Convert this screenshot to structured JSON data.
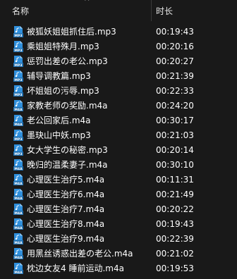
{
  "header": {
    "name_label": "名称",
    "duration_label": "时长",
    "sort_icon": "chevron-up-icon"
  },
  "files": [
    {
      "name": "被狐妖姐姐抓住后.mp3",
      "duration": "00:19:43",
      "type": "MP3"
    },
    {
      "name": "乘姐姐特殊月.mp3",
      "duration": "00:20:16",
      "type": "MP3"
    },
    {
      "name": "惩罚出差の老公.mp3",
      "duration": "00:20:27",
      "type": "MP3"
    },
    {
      "name": "辅导调教篇.mp3",
      "duration": "00:21:39",
      "type": "MP3"
    },
    {
      "name": "坏姐姐の污辱.mp3",
      "duration": "00:22:33",
      "type": "MP3"
    },
    {
      "name": "家教老师の奖励.m4a",
      "duration": "00:24:20",
      "type": "M4A"
    },
    {
      "name": "老公回家后.m4a",
      "duration": "00:30:17",
      "type": "M4A"
    },
    {
      "name": "墨玦山中妖.mp3",
      "duration": "00:21:03",
      "type": "MP3"
    },
    {
      "name": "女大学生の秘密.mp3",
      "duration": "00:20:14",
      "type": "MP3"
    },
    {
      "name": "晚归的温柔妻子.m4a",
      "duration": "00:30:10",
      "type": "M4A"
    },
    {
      "name": "心理医生治疗5.m4a",
      "duration": "00:11:31",
      "type": "M4A"
    },
    {
      "name": "心理医生治疗6.m4a",
      "duration": "00:21:49",
      "type": "M4A"
    },
    {
      "name": "心理医生治疗7.m4a",
      "duration": "00:20:22",
      "type": "M4A"
    },
    {
      "name": "心理医生治疗8.m4a",
      "duration": "00:19:43",
      "type": "M4A"
    },
    {
      "name": "心理医生治疗9.m4a",
      "duration": "00:22:39",
      "type": "M4A"
    },
    {
      "name": "用黑丝诱惑出差の老公.m4a",
      "duration": "00:21:02",
      "type": "M4A"
    },
    {
      "name": "枕边女友4 睡前运动.m4a",
      "duration": "00:19:53",
      "type": "M4A"
    }
  ],
  "colors": {
    "background": "#191919",
    "icon_blue": "#2a8bd6",
    "text": "#ffffff"
  }
}
